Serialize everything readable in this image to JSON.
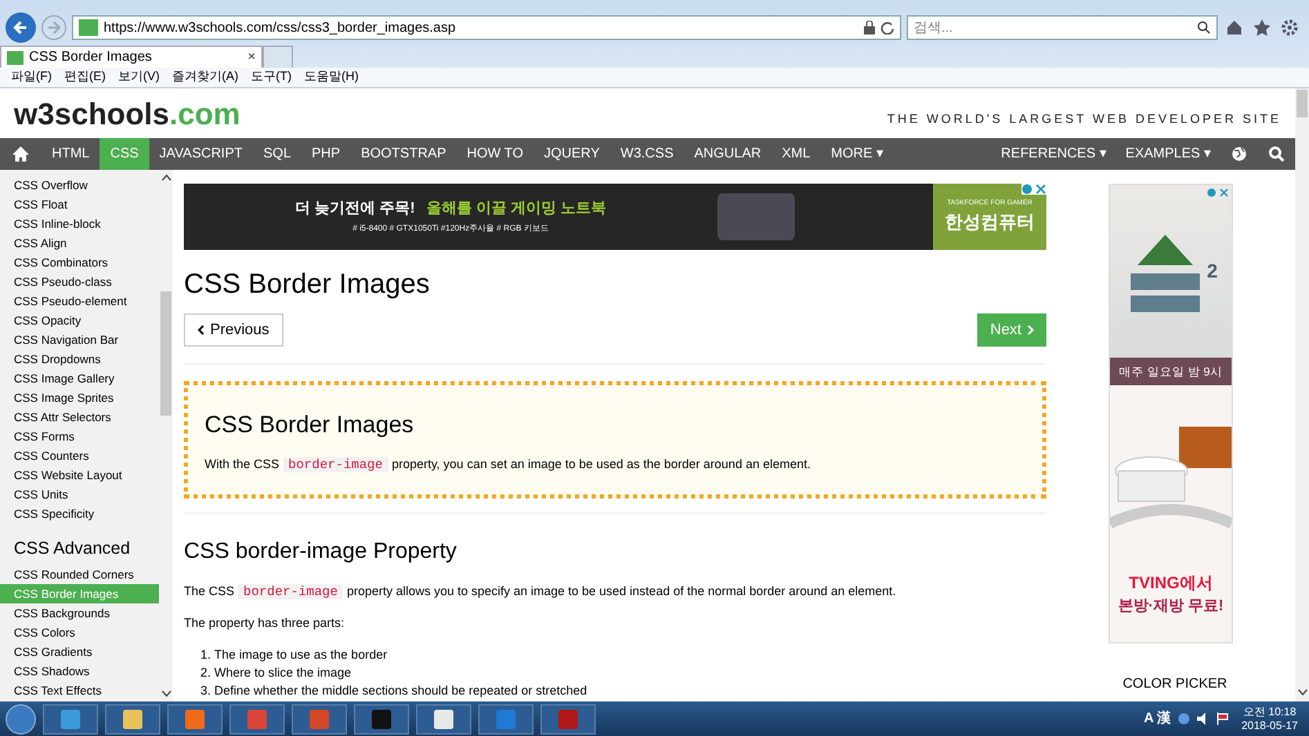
{
  "browser": {
    "address": "https://www.w3schools.com/css/css3_border_images.asp",
    "search_placeholder": "검색...",
    "tab": {
      "title": "CSS Border Images",
      "close": "×"
    },
    "menu": [
      "파일(F)",
      "편집(E)",
      "보기(V)",
      "즐겨찾기(A)",
      "도구(T)",
      "도움말(H)"
    ]
  },
  "site": {
    "logo": "w3schools",
    "logo_tld": ".com",
    "tagline": "THE WORLD'S LARGEST WEB DEVELOPER SITE",
    "nav": [
      {
        "label": "HTML",
        "selected": false
      },
      {
        "label": "CSS",
        "selected": true
      },
      {
        "label": "JAVASCRIPT",
        "selected": false
      },
      {
        "label": "SQL",
        "selected": false
      },
      {
        "label": "PHP",
        "selected": false
      },
      {
        "label": "BOOTSTRAP",
        "selected": false
      },
      {
        "label": "HOW TO",
        "selected": false
      },
      {
        "label": "JQUERY",
        "selected": false
      },
      {
        "label": "W3.CSS",
        "selected": false
      },
      {
        "label": "ANGULAR",
        "selected": false
      },
      {
        "label": "XML",
        "selected": false
      },
      {
        "label": "MORE ▾",
        "selected": false
      }
    ],
    "nav_right": [
      "REFERENCES ▾",
      "EXAMPLES ▾"
    ]
  },
  "sidebar": {
    "items": [
      {
        "label": "CSS Overflow",
        "selected": false
      },
      {
        "label": "CSS Float",
        "selected": false
      },
      {
        "label": "CSS Inline-block",
        "selected": false
      },
      {
        "label": "CSS Align",
        "selected": false
      },
      {
        "label": "CSS Combinators",
        "selected": false
      },
      {
        "label": "CSS Pseudo-class",
        "selected": false
      },
      {
        "label": "CSS Pseudo-element",
        "selected": false
      },
      {
        "label": "CSS Opacity",
        "selected": false
      },
      {
        "label": "CSS Navigation Bar",
        "selected": false
      },
      {
        "label": "CSS Dropdowns",
        "selected": false
      },
      {
        "label": "CSS Image Gallery",
        "selected": false
      },
      {
        "label": "CSS Image Sprites",
        "selected": false
      },
      {
        "label": "CSS Attr Selectors",
        "selected": false
      },
      {
        "label": "CSS Forms",
        "selected": false
      },
      {
        "label": "CSS Counters",
        "selected": false
      },
      {
        "label": "CSS Website Layout",
        "selected": false
      },
      {
        "label": "CSS Units",
        "selected": false
      },
      {
        "label": "CSS Specificity",
        "selected": false
      }
    ],
    "heading": "CSS Advanced",
    "advanced": [
      {
        "label": "CSS Rounded Corners",
        "selected": false
      },
      {
        "label": "CSS Border Images",
        "selected": true
      },
      {
        "label": "CSS Backgrounds",
        "selected": false
      },
      {
        "label": "CSS Colors",
        "selected": false
      },
      {
        "label": "CSS Gradients",
        "selected": false
      },
      {
        "label": "CSS Shadows",
        "selected": false
      },
      {
        "label": "CSS Text Effects",
        "selected": false
      }
    ]
  },
  "banner_ad": {
    "headline": "더 늦기전에 주목!",
    "subline": "올해를 이끌 게이밍 노트북",
    "specs": "# i5-8400  # GTX1050Ti  #120Hz주사율  # RGB 키보드",
    "brand_small": "TASKFORCE FOR GAMER",
    "brand": "한성컴퓨터"
  },
  "main": {
    "title": "CSS Border Images",
    "prev": "Previous",
    "next": "Next",
    "intro": {
      "title": "CSS Border Images",
      "text_before": "With the CSS",
      "code": "border-image",
      "text_after": "property, you can set an image to be used as the border around an element."
    },
    "section_title": "CSS border-image Property",
    "section_text": {
      "text_before": "The CSS",
      "code": "border-image",
      "text_after": "property allows you to specify an image to be used instead of the normal border around an element."
    },
    "parts_intro": "The property has three parts:",
    "parts": [
      {
        "number": "1.",
        "text": "The image to use as the border"
      },
      {
        "number": "2.",
        "text": "Where to slice the image"
      },
      {
        "number": "3.",
        "text": "Define whether the middle sections should be repeated or stretched"
      }
    ]
  },
  "side_ad": {
    "title": "2",
    "tagline": "매주 일요일 밤 9시",
    "tving": "TVING에서",
    "tving_2": "본방·재방 무료!"
  },
  "color_picker": "COLOR PICKER",
  "taskbar": {
    "ime": "A 漢",
    "time": "오전 10:18",
    "date": "2018-05-17"
  }
}
